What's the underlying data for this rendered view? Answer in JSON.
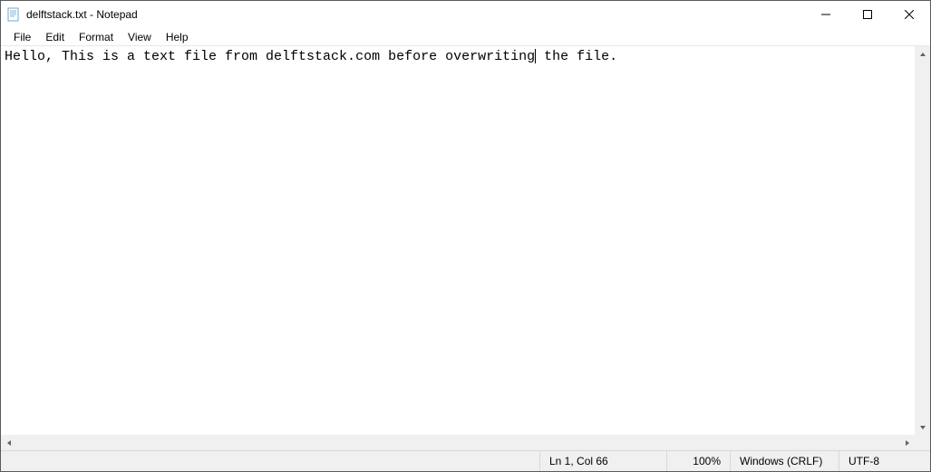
{
  "titlebar": {
    "title": "delftstack.txt - Notepad"
  },
  "menubar": {
    "items": [
      "File",
      "Edit",
      "Format",
      "View",
      "Help"
    ]
  },
  "editor": {
    "text_before_caret": "Hello, This is a text file from delftstack.com before overwriting",
    "text_after_caret": " the file."
  },
  "statusbar": {
    "position": "Ln 1, Col 66",
    "zoom": "100%",
    "line_ending": "Windows (CRLF)",
    "encoding": "UTF-8"
  }
}
